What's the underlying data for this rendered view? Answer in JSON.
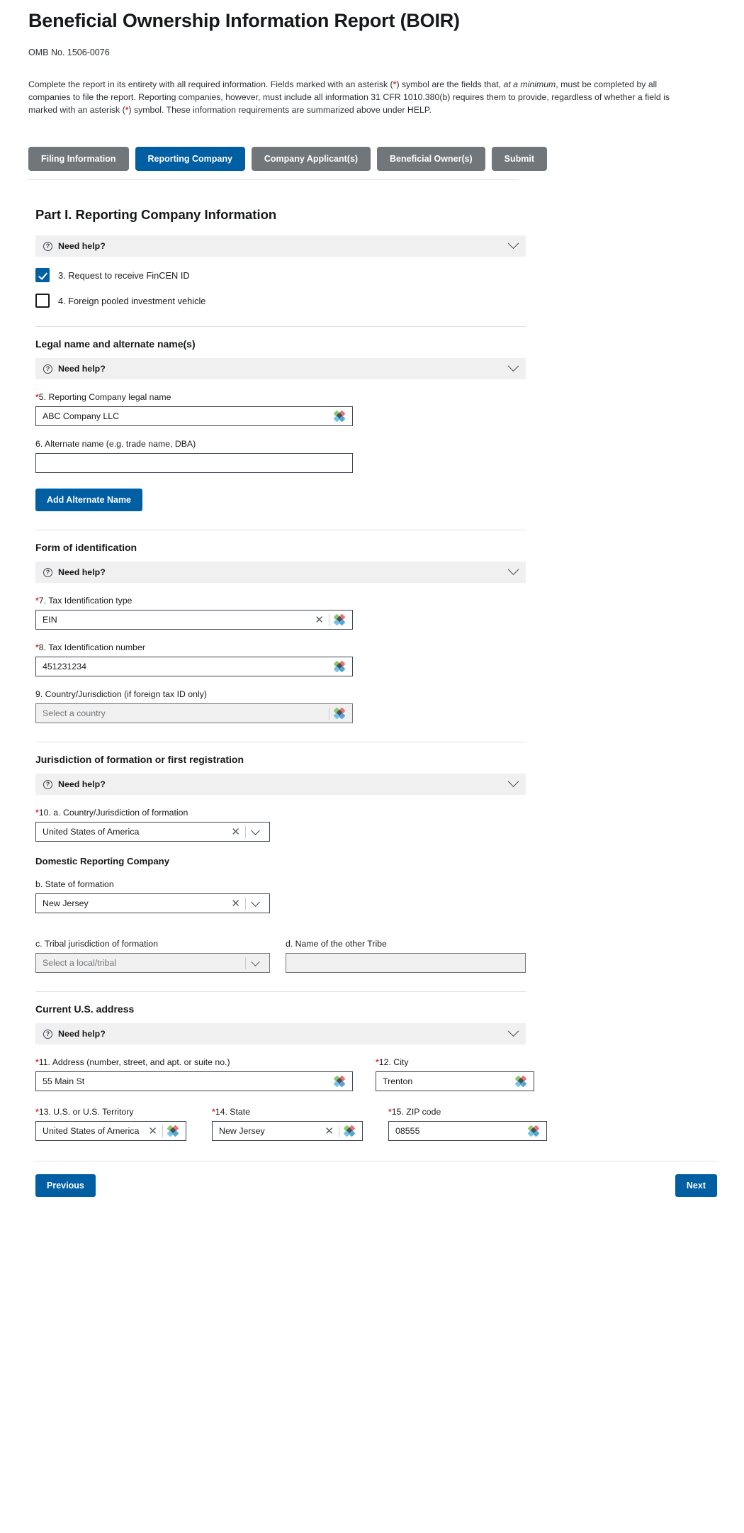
{
  "header": {
    "title": "Beneficial Ownership Information Report (BOIR)",
    "omb": "OMB No. 1506-0076",
    "intro_1": "Complete the report in its entirety with all required information. Fields marked with an asterisk (",
    "intro_ast1": "*",
    "intro_2": ") symbol are the fields that, ",
    "intro_em": "at a minimum",
    "intro_3": ", must be completed by all companies to file the report. Reporting companies, however, must include all information 31 CFR 1010.380(b) requires them to provide, regardless of whether a field is marked with an asterisk (",
    "intro_ast2": "*",
    "intro_4": ") symbol. These information requirements are summarized above under HELP."
  },
  "tabs": [
    {
      "label": "Filing Information",
      "active": false
    },
    {
      "label": "Reporting Company",
      "active": true
    },
    {
      "label": "Company Applicant(s)",
      "active": false
    },
    {
      "label": "Beneficial Owner(s)",
      "active": false
    },
    {
      "label": "Submit",
      "active": false
    }
  ],
  "part": {
    "title": "Part I. Reporting Company Information"
  },
  "need_help_label": "Need help?",
  "checkboxes": [
    {
      "label": "3. Request to receive FinCEN ID",
      "checked": true
    },
    {
      "label": "4. Foreign pooled investment vehicle",
      "checked": false
    }
  ],
  "legal_name_section": {
    "heading": "Legal name and alternate name(s)",
    "field5_label_num": "5. Reporting Company legal name",
    "field5_value": "ABC Company LLC",
    "field6_label": "6. Alternate name (e.g. trade name, DBA)",
    "field6_value": "",
    "add_button": "Add Alternate Name"
  },
  "form_id_section": {
    "heading": "Form of identification",
    "field7_label": "7. Tax Identification type",
    "field7_value": "EIN",
    "field8_label": "8. Tax Identification number",
    "field8_value": "451231234",
    "field9_label": "9. Country/Jurisdiction (if foreign tax ID only)",
    "field9_placeholder": "Select a country"
  },
  "jurisdiction_section": {
    "heading": "Jurisdiction of formation or first registration",
    "field10a_label": "10. a. Country/Jurisdiction of formation",
    "field10a_value": "United States of America",
    "subhead": "Domestic Reporting Company",
    "field10b_label": "b. State of formation",
    "field10b_value": "New Jersey",
    "field10c_label": "c. Tribal jurisdiction of formation",
    "field10c_placeholder": "Select a local/tribal",
    "field10d_label": "d. Name of the other Tribe",
    "field10d_value": ""
  },
  "address_section": {
    "heading": "Current U.S. address",
    "field11_label": "11. Address (number, street, and apt. or suite no.)",
    "field11_value": "55 Main St",
    "field12_label": "12. City",
    "field12_value": "Trenton",
    "field13_label": "13. U.S. or U.S. Territory",
    "field13_value": "United States of America",
    "field14_label": "14. State",
    "field14_value": "New Jersey",
    "field15_label": "15. ZIP code",
    "field15_value": "08555"
  },
  "footer": {
    "previous": "Previous",
    "next": "Next"
  },
  "symbols": {
    "asterisk": "*",
    "clear": "✕",
    "question": "?"
  },
  "colors": {
    "accent": "#005ea2",
    "tab_inactive": "#71767a",
    "required_red": "#d83933",
    "help_bg": "#f0f0f0"
  }
}
